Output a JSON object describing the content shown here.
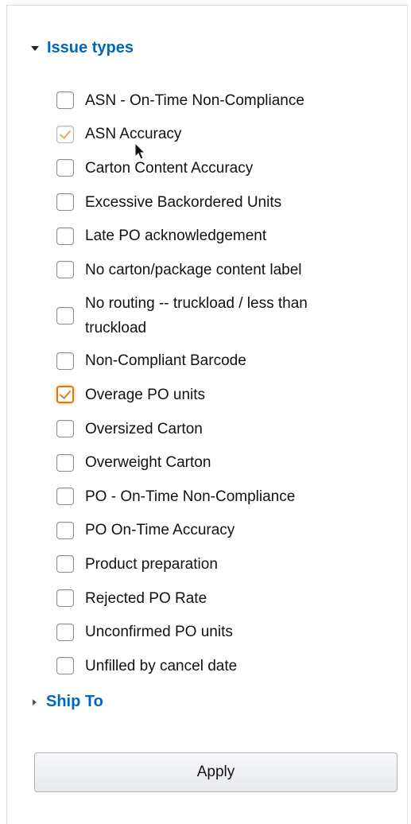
{
  "filters": {
    "issue_types": {
      "title": "Issue types",
      "items": [
        {
          "label": "ASN - On-Time Non-Compliance",
          "checked": false
        },
        {
          "label": "ASN Accuracy",
          "checked": true
        },
        {
          "label": "Carton Content Accuracy",
          "checked": false
        },
        {
          "label": "Excessive Backordered Units",
          "checked": false
        },
        {
          "label": "Late PO acknowledgement",
          "checked": false
        },
        {
          "label": "No carton/package content label",
          "checked": false
        },
        {
          "label": "No routing -- truckload / less than truckload",
          "checked": false
        },
        {
          "label": "Non-Compliant Barcode",
          "checked": false
        },
        {
          "label": "Overage PO units",
          "checked": true
        },
        {
          "label": "Oversized Carton",
          "checked": false
        },
        {
          "label": "Overweight Carton",
          "checked": false
        },
        {
          "label": "PO - On-Time Non-Compliance",
          "checked": false
        },
        {
          "label": "PO On-Time Accuracy",
          "checked": false
        },
        {
          "label": "Product preparation",
          "checked": false
        },
        {
          "label": "Rejected PO Rate",
          "checked": false
        },
        {
          "label": "Unconfirmed PO units",
          "checked": false
        },
        {
          "label": "Unfilled by cancel date",
          "checked": false
        }
      ]
    },
    "ship_to": {
      "title": "Ship To"
    },
    "apply_label": "Apply"
  },
  "colors": {
    "link": "#0066c0",
    "check": "#e47911",
    "focus_border": "#e77600"
  }
}
